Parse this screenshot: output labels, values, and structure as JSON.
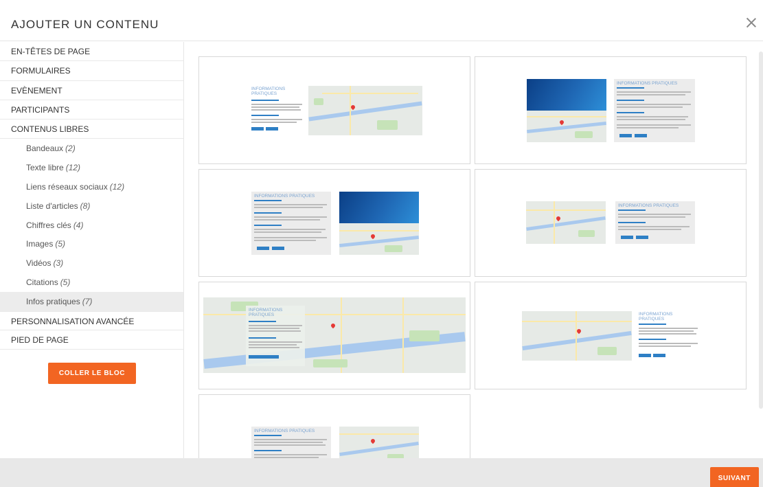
{
  "dialog": {
    "title": "AJOUTER UN CONTENU"
  },
  "sidebar": {
    "categories_top": [
      {
        "label": "EN-TÊTES DE PAGE"
      },
      {
        "label": "FORMULAIRES"
      },
      {
        "label": "EVÈNEMENT"
      },
      {
        "label": "PARTICIPANTS"
      },
      {
        "label": "CONTENUS LIBRES"
      }
    ],
    "subitems": [
      {
        "label": "Bandeaux",
        "count": "(2)"
      },
      {
        "label": "Texte libre",
        "count": "(12)"
      },
      {
        "label": "Liens réseaux sociaux",
        "count": "(12)"
      },
      {
        "label": "Liste d'articles",
        "count": "(8)"
      },
      {
        "label": "Chiffres clés",
        "count": "(4)"
      },
      {
        "label": "Images",
        "count": "(5)"
      },
      {
        "label": "Vidéos",
        "count": "(3)"
      },
      {
        "label": "Citations",
        "count": "(5)"
      },
      {
        "label": "Infos pratiques",
        "count": "(7)"
      }
    ],
    "active_subitem": "Infos pratiques",
    "categories_bottom": [
      {
        "label": "PERSONNALISATION AVANCÉE"
      },
      {
        "label": "PIED DE PAGE"
      }
    ],
    "paste_button": "COLLER LE BLOC"
  },
  "preview_text": {
    "heading": "INFORMATIONS PRATIQUES",
    "heading_line1": "INFORMATIONS",
    "heading_line2": "PRATIQUES"
  },
  "footer": {
    "next_button": "SUIVANT"
  },
  "colors": {
    "accent": "#f26522",
    "link_blue": "#2e7fc5",
    "active_bg": "#ececec"
  },
  "icons": {
    "close": "close-icon",
    "map_marker": "map-pin-icon"
  }
}
